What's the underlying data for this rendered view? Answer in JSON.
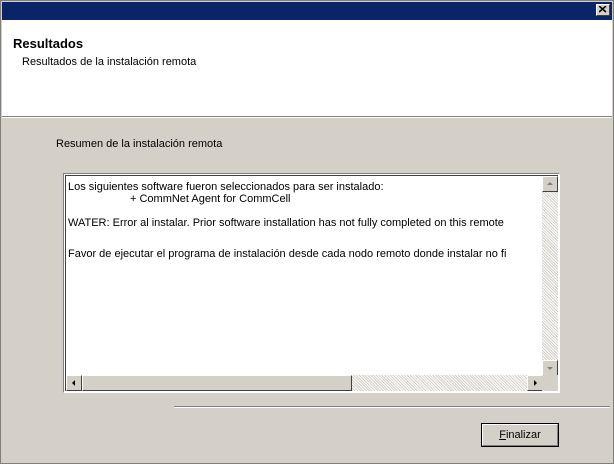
{
  "window": {
    "close_icon": "close-icon"
  },
  "header": {
    "title": "Resultados",
    "subtitle": "Resultados de la instalación remota"
  },
  "summary": {
    "label": "Resumen de la instalación remota",
    "lines": [
      "Los siguientes software fueron seleccionados para ser instalado:",
      "+ CommNet Agent for CommCell",
      "WATER:  Error al instalar. Prior software installation has not fully completed on this remote",
      "Favor de ejecutar el programa de instalación desde cada nodo remoto donde instalar no fi"
    ]
  },
  "buttons": {
    "finish_mnemonic": "F",
    "finish_rest": "inalizar"
  },
  "colors": {
    "titlebar": "#0a246a",
    "dialog_bg": "#d4d0c8",
    "header_bg": "#ffffff"
  }
}
